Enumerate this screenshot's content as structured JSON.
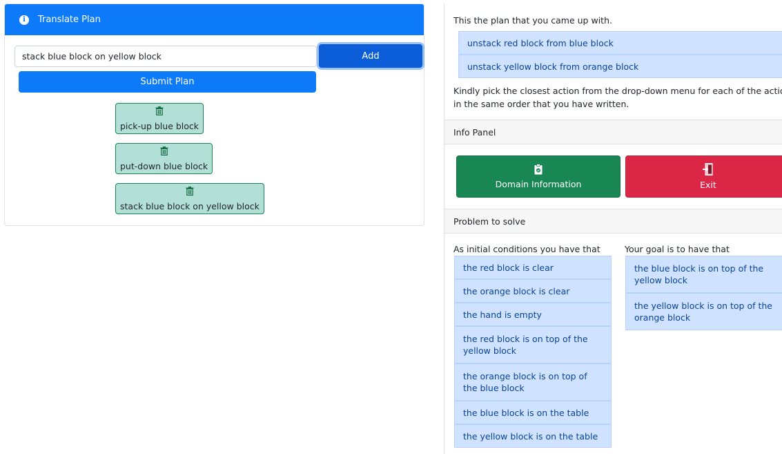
{
  "translate_panel": {
    "title": "Translate Plan",
    "input_value": "stack blue block on yellow block",
    "add_label": "Add",
    "submit_label": "Submit Plan",
    "plan_items": [
      "pick-up blue block",
      "put-down blue block",
      "stack blue block on yellow block"
    ],
    "header_icon": "info-circle-icon",
    "item_icon": "trash-icon"
  },
  "plan_panel": {
    "intro": "This the plan that you came up with.",
    "steps": [
      "unstack red block from blue block",
      "unstack yellow block from orange block"
    ],
    "instruction_line1": "Kindly pick the closest action from the drop-down menu for each of the actions",
    "instruction_line2": "in the same order that you have written."
  },
  "info_panel": {
    "title": "Info Panel",
    "domain_button": "Domain Information",
    "exit_button": "Exit",
    "domain_icon": "clipboard-check-icon",
    "exit_icon": "door-exit-icon"
  },
  "problem": {
    "title": "Problem to solve",
    "initial_label": "As initial conditions you have that",
    "goal_label": "Your goal is to have that",
    "initial": [
      "the red block is clear",
      "the orange block is clear",
      "the hand is empty",
      "the red block is on top of the yellow block",
      "the orange block is on top of the blue block",
      "the blue block is on the table",
      "the yellow block is on the table"
    ],
    "goals": [
      "the blue block is on top of the yellow block",
      "the yellow block is on top of the orange block"
    ]
  },
  "colors": {
    "primary": "#0d7bf9",
    "success": "#198754",
    "danger": "#dc2645",
    "item_background": "#cfe2ff",
    "item_text": "#084298",
    "chip_background": "#b2e0d7"
  }
}
